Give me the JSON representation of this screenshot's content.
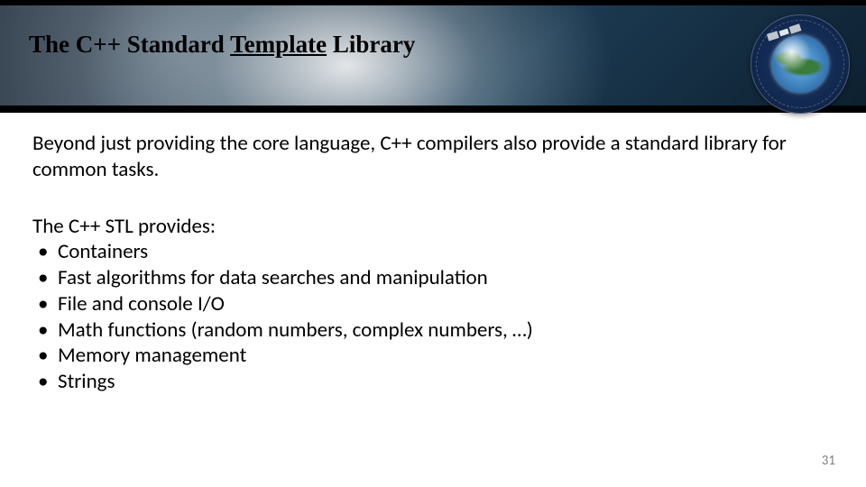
{
  "header": {
    "title_pre": "The C++ Standard ",
    "title_underlined": "Template",
    "title_post": " Library"
  },
  "logo": {
    "name": "jcsda-logo"
  },
  "body": {
    "intro": "Beyond just providing the core language, C++ compilers also provide a standard library for common tasks.",
    "list_heading": "The C++ STL provides:",
    "items": [
      "Containers",
      "Fast algorithms for data searches and manipulation",
      "File and console I/O",
      "Math functions (random numbers, complex numbers, …)",
      "Memory management",
      "Strings"
    ]
  },
  "page_number": "31"
}
